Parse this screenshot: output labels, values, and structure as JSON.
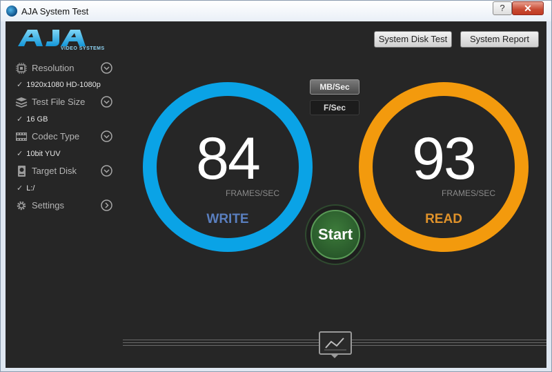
{
  "window": {
    "title": "AJA System Test",
    "help_label": "?",
    "close_label": "✕"
  },
  "logo": {
    "text": "AJA",
    "subtitle": "VIDEO SYSTEMS"
  },
  "sidebar": {
    "items": [
      {
        "label": "Resolution",
        "icon": "resolution-chip-icon",
        "value": "1920x1080 HD-1080p",
        "control": "chevron-down"
      },
      {
        "label": "Test File Size",
        "icon": "stack-icon",
        "value": "16 GB",
        "control": "chevron-down"
      },
      {
        "label": "Codec Type",
        "icon": "film-strip-icon",
        "value": "10bit YUV",
        "control": "chevron-down"
      },
      {
        "label": "Target Disk",
        "icon": "disk-icon",
        "value": "L:/",
        "control": "chevron-down"
      },
      {
        "label": "Settings",
        "icon": "gear-icon",
        "control": "chevron-right"
      }
    ],
    "check_mark": "✓"
  },
  "toolbar": {
    "system_disk_test": "System Disk Test",
    "system_report": "System Report"
  },
  "units": {
    "mb_sec": "MB/Sec",
    "f_sec": "F/Sec",
    "selected": "MB/Sec"
  },
  "write": {
    "value": "84",
    "unit": "FRAMES/SEC",
    "label": "WRITE",
    "color": "#0aa3e6",
    "label_color": "#5a7fbf"
  },
  "read": {
    "value": "93",
    "unit": "FRAMES/SEC",
    "label": "READ",
    "color": "#f39a0d",
    "label_color": "#e0922a"
  },
  "start": {
    "label": "Start",
    "color": "#3c7a3a"
  },
  "graph": {
    "icon": "line-graph-icon"
  }
}
